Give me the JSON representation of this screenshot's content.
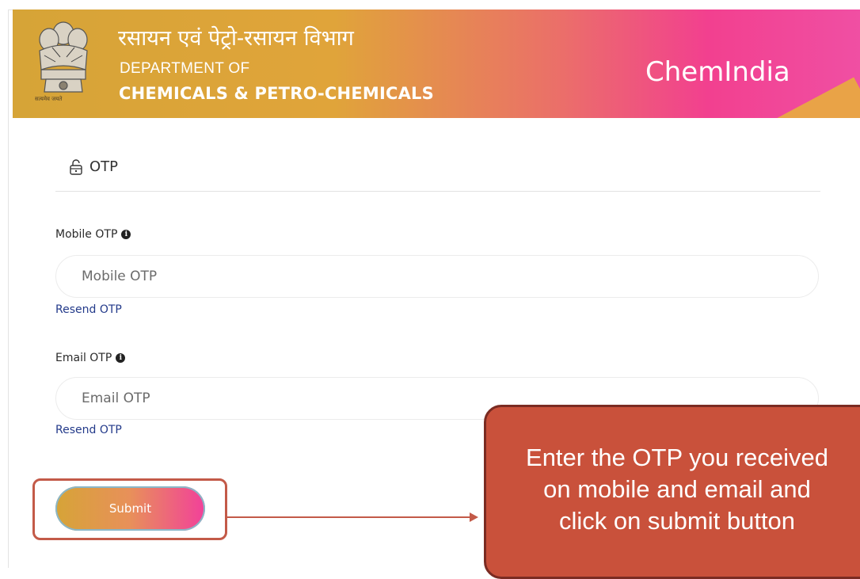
{
  "header": {
    "hindi_title": "रसायन एवं पेट्रो-रसायन विभाग",
    "dept_line1": "DEPARTMENT OF",
    "dept_line2": "CHEMICALS & PETRO-CHEMICALS",
    "brand": "ChemIndia",
    "emblem_caption": "सत्यमेव जयते"
  },
  "form": {
    "section_title": "OTP",
    "mobile_label": "Mobile OTP",
    "mobile_placeholder": "Mobile OTP",
    "mobile_value": "",
    "resend_mobile": "Resend OTP",
    "email_label": "Email OTP",
    "email_placeholder": "Email OTP",
    "email_value": "",
    "resend_email": "Resend OTP",
    "submit_label": "Submit"
  },
  "callout": {
    "text": "Enter the OTP you received\non mobile and email and\nclick on submit button"
  },
  "colors": {
    "header_start": "#d6a437",
    "header_end": "#f04fa3",
    "callout": "#c9513b",
    "link": "#233a8a"
  }
}
